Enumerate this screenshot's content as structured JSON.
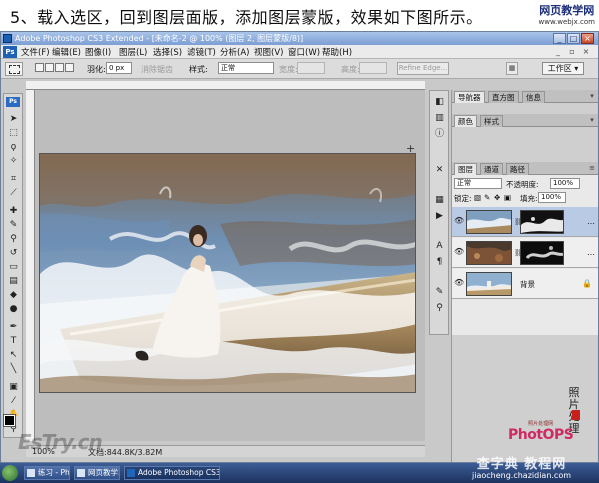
{
  "caption": {
    "text": "5、载入选区，回到图层面版，添加图层蒙版，效果如下图所示。"
  },
  "watermark_top": {
    "name": "网页教学网",
    "url": "www.webjx.com"
  },
  "window": {
    "title": "Adobe Photoshop CS3 Extended - [未命名-2 @ 100% (图层 2, 图层蒙版/8)]",
    "controls": {
      "minimize": "_",
      "maximize": "□",
      "close": "×"
    }
  },
  "menubar": {
    "badge": "Ps",
    "items": [
      "文件(F)",
      "编辑(E)",
      "图像(I)",
      "图层(L)",
      "选择(S)",
      "滤镜(T)",
      "分析(A)",
      "视图(V)",
      "窗口(W)",
      "帮助(H)"
    ],
    "doc_controls": {
      "minimize": "_",
      "restore": "▫",
      "close": "×"
    }
  },
  "options": {
    "feather_label": "羽化:",
    "feather_value": "0 px",
    "antialias_label": "消除锯齿",
    "style_label": "样式:",
    "style_value": "正常",
    "width_label": "宽度:",
    "height_label": "高度:",
    "refine_edge": "Refine Edge...",
    "workspace": "工作区 ▾"
  },
  "toolbox": {
    "badge": "Ps"
  },
  "status": {
    "zoom": "100%",
    "docinfo": "文档:844.8K/3.82M"
  },
  "panels": {
    "group1": {
      "tabs": [
        "导航器",
        "直方图",
        "信息"
      ]
    },
    "group2": {
      "tabs": [
        "颜色",
        "样式"
      ]
    },
    "group3": {
      "tabs": [
        "图层",
        "通道",
        "路径"
      ]
    },
    "blend_mode": "正常",
    "opacity_label": "不透明度:",
    "opacity_value": "100%",
    "lock_label": "锁定:",
    "fill_label": "填充:",
    "fill_value": "100%",
    "layers": [
      {
        "name": "",
        "has_mask": true,
        "selected": true
      },
      {
        "name": "",
        "has_mask": true,
        "selected": false
      },
      {
        "name": "背景",
        "has_mask": false,
        "selected": false,
        "locked": true
      }
    ]
  },
  "watermarks": {
    "estry": "EsTry.cn",
    "logo_small": "照片处理网",
    "logo_big": "PhotOPS",
    "calligraphy": [
      "照",
      "片",
      "处",
      "理"
    ],
    "bottom_cn": "查字典 教程网",
    "bottom_url": "jiaocheng.chazidian.com"
  },
  "taskbar": {
    "items": [
      {
        "label": "练习 - Photoshop",
        "active": false
      },
      {
        "label": "网页教学...",
        "active": false
      },
      {
        "label": "Adobe Photoshop CS3...",
        "active": true
      }
    ]
  },
  "colors": {
    "accent": "#2066b8",
    "title_bar": "#7c9ed3",
    "panel_bg": "#cfcfcf",
    "selection": "#b9cbe4"
  }
}
